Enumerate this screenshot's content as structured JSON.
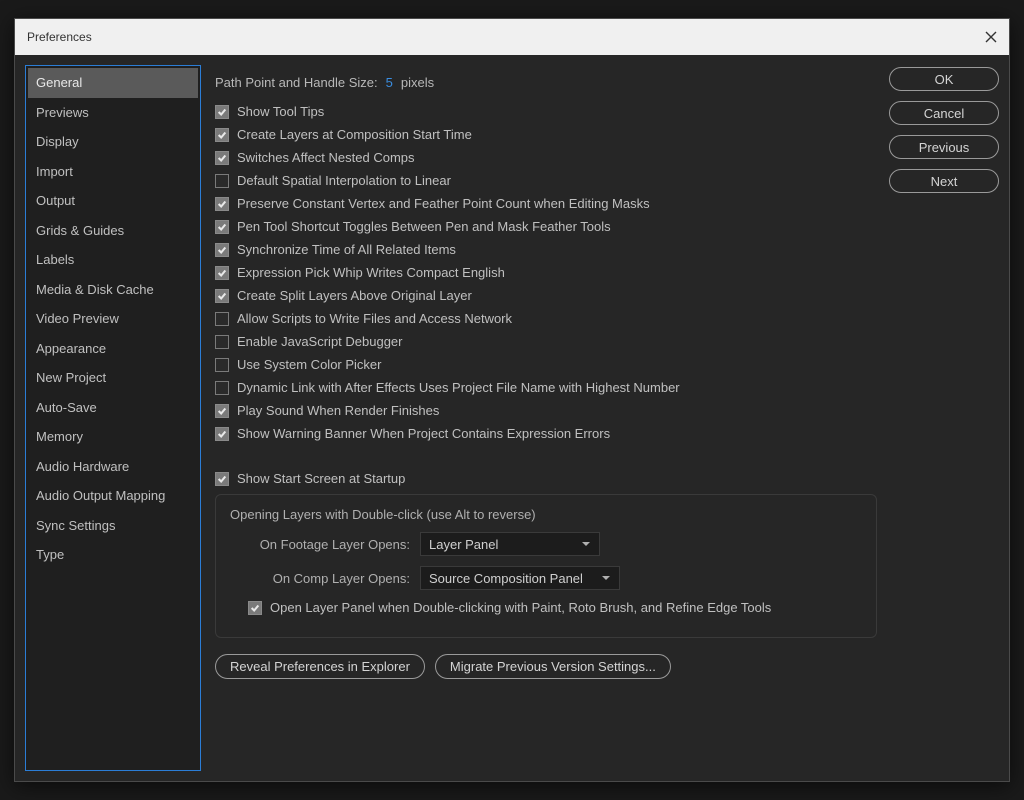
{
  "window": {
    "title": "Preferences"
  },
  "sidebar": {
    "items": [
      "General",
      "Previews",
      "Display",
      "Import",
      "Output",
      "Grids & Guides",
      "Labels",
      "Media & Disk Cache",
      "Video Preview",
      "Appearance",
      "New Project",
      "Auto-Save",
      "Memory",
      "Audio Hardware",
      "Audio Output Mapping",
      "Sync Settings",
      "Type"
    ],
    "selected_index": 0
  },
  "buttons": {
    "ok": "OK",
    "cancel": "Cancel",
    "previous": "Previous",
    "next": "Next",
    "reveal": "Reveal Preferences in Explorer",
    "migrate": "Migrate Previous Version Settings..."
  },
  "path_field": {
    "label": "Path Point and Handle Size:",
    "value": "5",
    "unit": "pixels"
  },
  "checkboxes": [
    {
      "label": "Show Tool Tips",
      "checked": true
    },
    {
      "label": "Create Layers at Composition Start Time",
      "checked": true
    },
    {
      "label": "Switches Affect Nested Comps",
      "checked": true
    },
    {
      "label": "Default Spatial Interpolation to Linear",
      "checked": false
    },
    {
      "label": "Preserve Constant Vertex and Feather Point Count when Editing Masks",
      "checked": true
    },
    {
      "label": "Pen Tool Shortcut Toggles Between Pen and Mask Feather Tools",
      "checked": true
    },
    {
      "label": "Synchronize Time of All Related Items",
      "checked": true
    },
    {
      "label": "Expression Pick Whip Writes Compact English",
      "checked": true
    },
    {
      "label": "Create Split Layers Above Original Layer",
      "checked": true
    },
    {
      "label": "Allow Scripts to Write Files and Access Network",
      "checked": false
    },
    {
      "label": "Enable JavaScript Debugger",
      "checked": false
    },
    {
      "label": "Use System Color Picker",
      "checked": false
    },
    {
      "label": "Dynamic Link with After Effects Uses Project File Name with Highest Number",
      "checked": false
    },
    {
      "label": "Play Sound When Render Finishes",
      "checked": true
    },
    {
      "label": "Show Warning Banner When Project Contains Expression Errors",
      "checked": true
    }
  ],
  "start_screen": {
    "label": "Show Start Screen at Startup",
    "checked": true
  },
  "opening_group": {
    "legend": "Opening Layers with Double-click (use Alt to reverse)",
    "footage_label": "On Footage Layer Opens:",
    "footage_value": "Layer Panel",
    "comp_label": "On Comp Layer Opens:",
    "comp_value": "Source Composition Panel",
    "open_layer_panel": {
      "label": "Open Layer Panel when Double-clicking with Paint, Roto Brush, and Refine Edge Tools",
      "checked": true
    }
  }
}
